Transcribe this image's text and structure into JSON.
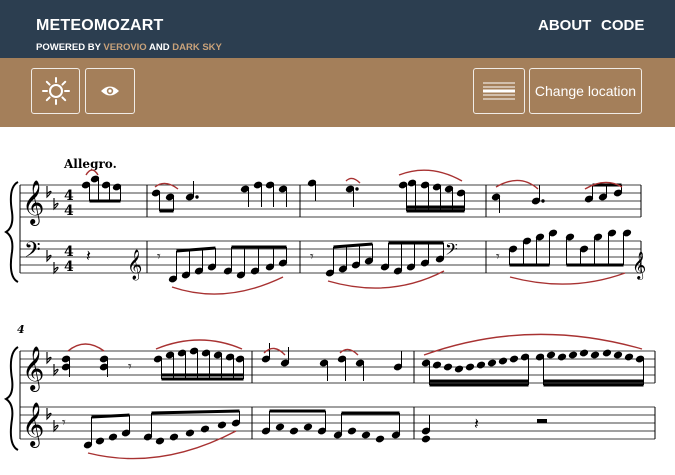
{
  "header": {
    "brand": "METEOMOZART",
    "powered_prefix": "POWERED BY",
    "powered_link1": "VEROVIO",
    "powered_and": "AND",
    "powered_link2": "DARK SKY",
    "nav": [
      "ABOUT",
      "CODE"
    ]
  },
  "toolbar": {
    "weather_icon": "sun-icon",
    "view_icon": "eye-icon",
    "layout_icon": "staff-layout-icon",
    "change_location_label": "Change location"
  },
  "score": {
    "tempo": "Allegro.",
    "system2_measure_number": "4",
    "time_signature": {
      "numerator": "4",
      "denominator": "4"
    },
    "key_signature": "B-flat major",
    "slur_color": "#a83232"
  }
}
